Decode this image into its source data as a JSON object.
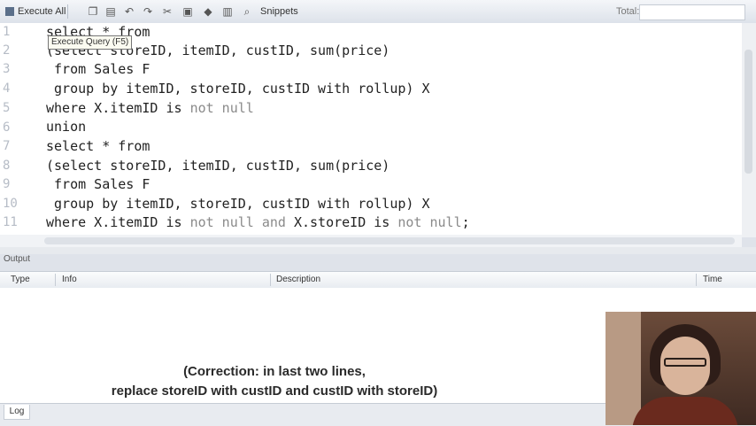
{
  "toolbar": {
    "execute_label": "Execute All",
    "snippets_label": "Snippets",
    "total_label": "Total:",
    "icons": [
      "copy-icon",
      "save-icon",
      "undo-icon",
      "redo-icon",
      "cut-icon",
      "paste-icon",
      "format-icon",
      "explain-icon",
      "search-icon"
    ]
  },
  "tooltip": "Execute Query (F5)",
  "editor": {
    "line_numbers": [
      "1",
      "2",
      "3",
      "4",
      "5",
      "6",
      "7",
      "8",
      "9",
      "10",
      "11"
    ],
    "lines": [
      "select * from",
      "(select storeID, itemID, custID, sum(price)",
      " from Sales F",
      " group by itemID, storeID, custID with rollup) X",
      "where X.itemID is not null",
      "union",
      "select * from",
      "(select storeID, itemID, custID, sum(price)",
      " from Sales F",
      " group by itemID, storeID, custID with rollup) X",
      "where X.itemID is not null and X.storeID is not null;"
    ]
  },
  "output": {
    "title": "Output",
    "columns": [
      "Type",
      "Info",
      "Description",
      "Time"
    ]
  },
  "overlay": {
    "line1": "(Correction: in last two lines,",
    "line2": "replace storeID with custID and custID with storeID)"
  },
  "status": {
    "log_tab": "Log"
  },
  "colors": {
    "editor_bg": "#ffffff",
    "keyword_gray": "#8a8a8a",
    "line_number": "#b6bcc6"
  }
}
